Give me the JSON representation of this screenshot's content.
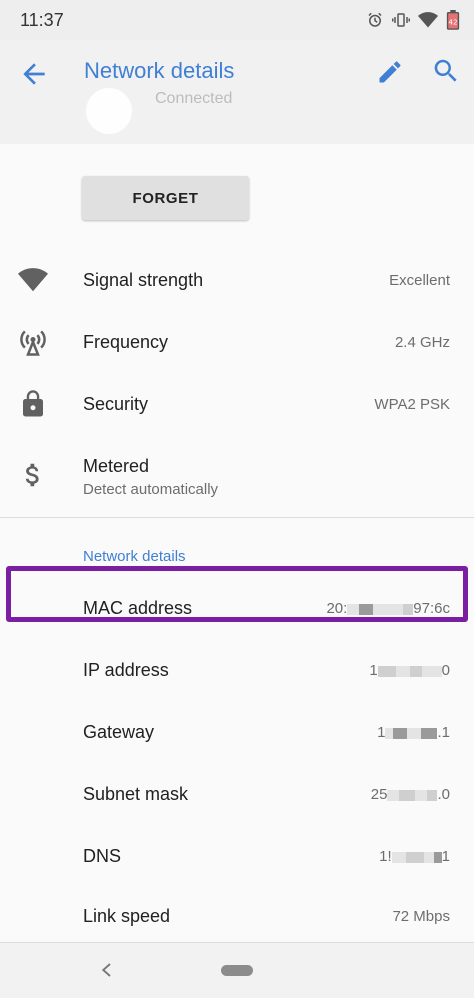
{
  "status_bar": {
    "time": "11:37",
    "icons": [
      "alarm-icon",
      "vibrate-icon",
      "wifi-icon",
      "battery-icon"
    ]
  },
  "app_bar": {
    "title": "Network details",
    "peek_status": "Connected"
  },
  "forget_button": {
    "label": "FORGET"
  },
  "info_rows": [
    {
      "title": "Signal strength",
      "value": "Excellent",
      "icon": "wifi-signal-icon"
    },
    {
      "title": "Frequency",
      "value": "2.4 GHz",
      "icon": "antenna-icon"
    },
    {
      "title": "Security",
      "value": "WPA2 PSK",
      "icon": "lock-icon"
    },
    {
      "title": "Metered",
      "subtitle": "Detect automatically",
      "icon": "dollar-icon"
    }
  ],
  "network_section": {
    "header": "Network details",
    "rows": [
      {
        "title": "MAC address",
        "value_start": "20:",
        "value_end": "97:6c"
      },
      {
        "title": "IP address",
        "value_start": "1",
        "value_end": "0"
      },
      {
        "title": "Gateway",
        "value_start": "1",
        "value_end": ".1"
      },
      {
        "title": "Subnet mask",
        "value_start": "25",
        "value_end": ".0"
      },
      {
        "title": "DNS",
        "value_start": "1!",
        "value_end": "1"
      },
      {
        "title": "Link speed",
        "value": "72 Mbps"
      }
    ]
  },
  "colors": {
    "accent": "#3f7fd4",
    "highlight": "#7b1fa2",
    "icon": "#616161"
  }
}
